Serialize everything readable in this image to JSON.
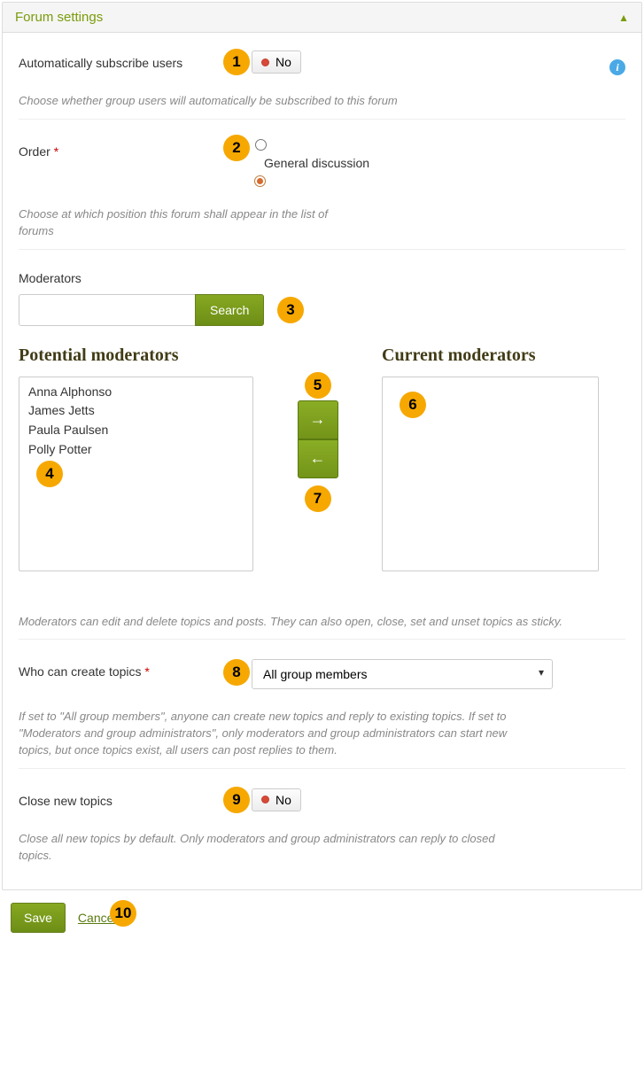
{
  "panel": {
    "title": "Forum settings"
  },
  "subscribe": {
    "label": "Automatically subscribe users",
    "toggle_value": "No",
    "hint": "Choose whether group users will automatically be subscribed to this forum"
  },
  "order": {
    "label": "Order",
    "option_label": "General discussion",
    "hint": "Choose at which position this forum shall appear in the list of forums"
  },
  "moderators": {
    "label": "Moderators",
    "search_button": "Search",
    "potential_title": "Potential moderators",
    "current_title": "Current moderators",
    "potential_list": [
      "Anna Alphonso",
      "James Jetts",
      "Paula Paulsen",
      "Polly Potter"
    ],
    "current_list": [],
    "hint": "Moderators can edit and delete topics and posts. They can also open, close, set and unset topics as sticky."
  },
  "create_topics": {
    "label": "Who can create topics",
    "selected": "All group members",
    "hint": "If set to \"All group members\", anyone can create new topics and reply to existing topics. If set to \"Moderators and group administrators\", only moderators and group administrators can start new topics, but once topics exist, all users can post replies to them."
  },
  "close_topics": {
    "label": "Close new topics",
    "toggle_value": "No",
    "hint": "Close all new topics by default. Only moderators and group administrators can reply to closed topics."
  },
  "footer": {
    "save": "Save",
    "cancel": "Cancel"
  },
  "badges": [
    "1",
    "2",
    "3",
    "4",
    "5",
    "6",
    "7",
    "8",
    "9",
    "10"
  ]
}
